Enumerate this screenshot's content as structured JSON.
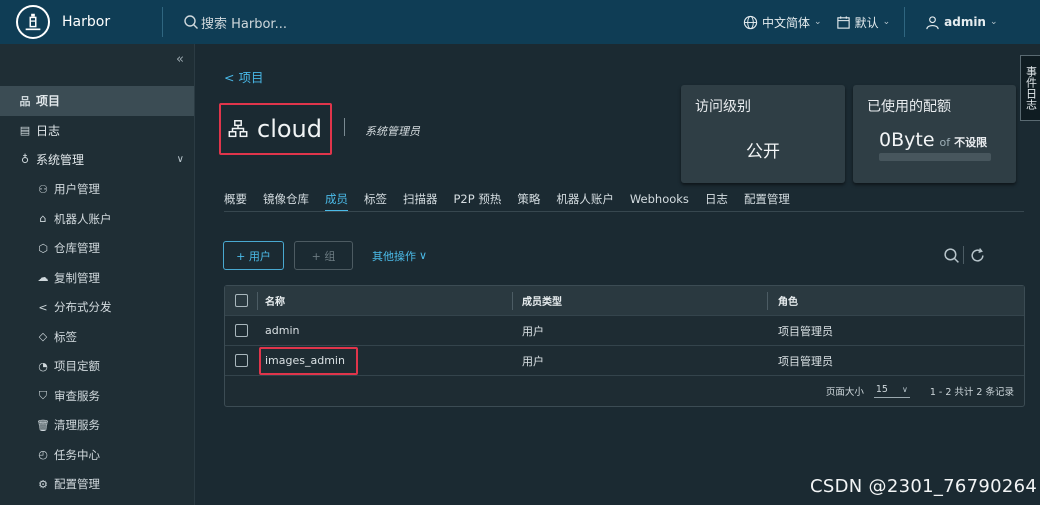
{
  "header": {
    "brand": "Harbor",
    "search_placeholder": "搜索 Harbor...",
    "language": "中文简体",
    "date_format": "默认",
    "user": "admin"
  },
  "sidebar": {
    "items": [
      {
        "label": "项目",
        "icon": "project-icon",
        "active": true
      },
      {
        "label": "日志",
        "icon": "log-icon"
      },
      {
        "label": "系统管理",
        "icon": "system-admin-icon",
        "expanded": true
      },
      {
        "label": "用户管理",
        "icon": "users-icon",
        "sub": true
      },
      {
        "label": "机器人账户",
        "icon": "robot-icon",
        "sub": true
      },
      {
        "label": "仓库管理",
        "icon": "registry-icon",
        "sub": true
      },
      {
        "label": "复制管理",
        "icon": "replication-icon",
        "sub": true
      },
      {
        "label": "分布式分发",
        "icon": "share-icon",
        "sub": true
      },
      {
        "label": "标签",
        "icon": "tag-icon",
        "sub": true
      },
      {
        "label": "项目定额",
        "icon": "quota-icon",
        "sub": true
      },
      {
        "label": "审查服务",
        "icon": "shield-icon",
        "sub": true
      },
      {
        "label": "清理服务",
        "icon": "trash-icon",
        "sub": true
      },
      {
        "label": "任务中心",
        "icon": "dashboard-icon",
        "sub": true
      },
      {
        "label": "配置管理",
        "icon": "gear-icon",
        "sub": true
      }
    ]
  },
  "project": {
    "back_label": "< 项目",
    "name": "cloud",
    "role": "系统管理员"
  },
  "cards": {
    "access": {
      "title": "访问级别",
      "value": "公开"
    },
    "quota": {
      "title": "已使用的配额",
      "used": "0Byte",
      "of": "of",
      "limit": "不设限"
    }
  },
  "event_tab": "事件日志",
  "tabs": [
    {
      "label": "概要"
    },
    {
      "label": "镜像仓库"
    },
    {
      "label": "成员",
      "active": true
    },
    {
      "label": "标签"
    },
    {
      "label": "扫描器"
    },
    {
      "label": "P2P 预热"
    },
    {
      "label": "策略"
    },
    {
      "label": "机器人账户"
    },
    {
      "label": "Webhooks"
    },
    {
      "label": "日志"
    },
    {
      "label": "配置管理"
    }
  ],
  "actions": {
    "add_user": "+ 用户",
    "add_group": "+ 组",
    "more": "其他操作"
  },
  "table": {
    "columns": [
      "名称",
      "成员类型",
      "角色"
    ],
    "rows": [
      {
        "name": "admin",
        "type": "用户",
        "role": "项目管理员"
      },
      {
        "name": "images_admin",
        "type": "用户",
        "role": "项目管理员"
      }
    ],
    "footer": {
      "page_size_label": "页面大小",
      "page_size": "15",
      "count": "1 - 2 共计 2 条记录"
    }
  },
  "watermark": "CSDN @2301_76790264"
}
